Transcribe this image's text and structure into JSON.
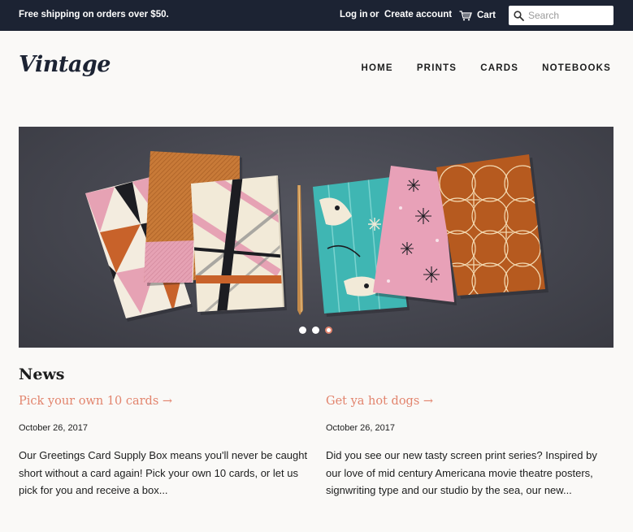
{
  "topbar": {
    "promo": "Free shipping on orders over $50.",
    "login": "Log in",
    "or": "or",
    "create_account": "Create account",
    "cart": "Cart",
    "search_placeholder": "Search"
  },
  "header": {
    "logo": "Vintage",
    "nav": [
      "HOME",
      "PRINTS",
      "CARDS",
      "NOTEBOOKS"
    ]
  },
  "slideshow": {
    "slide_count": 3,
    "active_index": 2
  },
  "news": {
    "title": "News",
    "articles": [
      {
        "headline": "Pick your own 10 cards →",
        "date": "October 26, 2017",
        "excerpt": "Our Greetings Card Supply Box means you'll never be caught short without a card again! Pick your own 10 cards, or let us pick for you and receive a box..."
      },
      {
        "headline": "Get ya hot dogs →",
        "date": "October 26, 2017",
        "excerpt": "Did you see our new tasty screen print series? Inspired by our love of mid century Americana movie theatre posters, signwriting type and our studio by the sea, our new..."
      }
    ]
  },
  "colors": {
    "topbar": "#1c2333",
    "accent": "#e2846d",
    "background": "#faf9f7",
    "hero_background": "#45464f"
  }
}
